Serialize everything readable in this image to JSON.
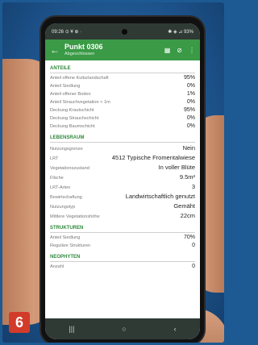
{
  "status": {
    "time": "09:26",
    "left_icons": "⊙ ¥ ⊕ ·",
    "right_icons": "✱ ◈ ⊿ 93%"
  },
  "appbar": {
    "back_icon": "←",
    "title": "Punkt 0306",
    "subtitle": "Abgeschlossen",
    "action_icons": [
      "▦",
      "⊘",
      "⋮"
    ]
  },
  "sections": [
    {
      "title": "ANTEILE",
      "rows": [
        {
          "label": "Anteil offene Kulturlandschaft",
          "value": "95%"
        },
        {
          "label": "Anteil Siedlung",
          "value": "0%"
        },
        {
          "label": "Anteil offener Boden",
          "value": "1%"
        },
        {
          "label": "Anteil Strauchvegetation < 1m",
          "value": "0%"
        },
        {
          "label": "Deckung Krautschicht",
          "value": "95%"
        },
        {
          "label": "Deckung Strauchschicht",
          "value": "0%"
        },
        {
          "label": "Deckung Baumschicht",
          "value": "0%"
        }
      ]
    },
    {
      "title": "LEBENSRAUM",
      "rows": [
        {
          "label": "Nutzungsgrenze",
          "value": "Nein"
        },
        {
          "label": "LRT",
          "value": "4512 Typische Fromentalwiese"
        },
        {
          "label": "Vegetationszustand",
          "value": "In voller Blüte"
        },
        {
          "label": "Fläche",
          "value": "9.5m²"
        },
        {
          "label": "LRT-Arten",
          "value": "3"
        },
        {
          "label": "Bewirtschaftung",
          "value": "Landwirtschaftlich genutzt"
        },
        {
          "label": "Nutzungstyp",
          "value": "Gemäht"
        },
        {
          "label": "Mittlere Vegetationshöhe",
          "value": "22cm"
        }
      ]
    },
    {
      "title": "STRUKTUREN",
      "rows": [
        {
          "label": "Anteil Siedlung",
          "value": "70%"
        },
        {
          "label": "Reguläre Strukturen",
          "value": "0"
        }
      ]
    },
    {
      "title": "NEOPHYTEN",
      "rows": [
        {
          "label": "Anzahl",
          "value": "0"
        }
      ]
    }
  ],
  "navbar": {
    "recent_icon": "|||",
    "home_icon": "○",
    "back_icon": "‹"
  },
  "badge": "6"
}
